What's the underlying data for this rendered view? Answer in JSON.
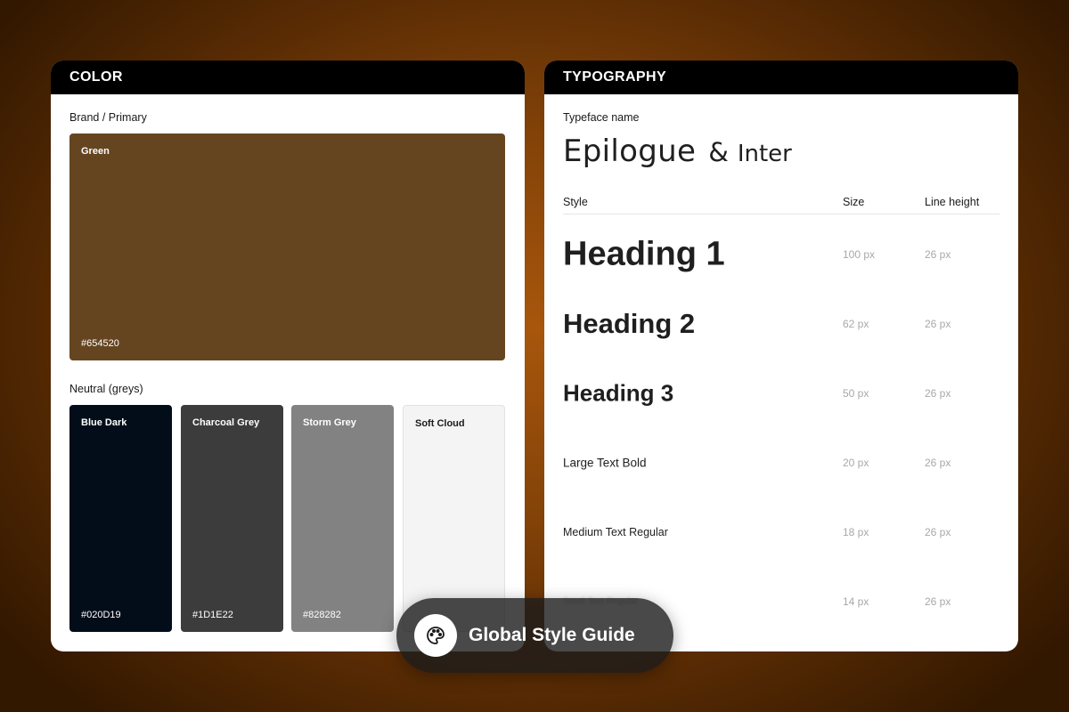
{
  "color_panel": {
    "title": "COLOR",
    "brand_label": "Brand / Primary",
    "brand": {
      "name": "Green",
      "hex": "#654520",
      "color": "#654520"
    },
    "neutral_label": "Neutral (greys)",
    "neutrals": [
      {
        "name": "Blue Dark",
        "hex": "#020D19",
        "color": "#020D19"
      },
      {
        "name": "Charcoal Grey",
        "hex": "#1D1E22",
        "color": "#3c3c3c"
      },
      {
        "name": "Storm Grey",
        "hex": "#828282",
        "color": "#828282"
      },
      {
        "name": "Soft Cloud",
        "hex": "",
        "color": "#f4f4f4"
      }
    ]
  },
  "typography_panel": {
    "title": "TYPOGRAPHY",
    "typeface_label": "Typeface name",
    "typeface_primary": "Epilogue",
    "typeface_amp": "&",
    "typeface_secondary": "Inter",
    "columns": {
      "style": "Style",
      "size": "Size",
      "line_height": "Line height"
    },
    "rows": [
      {
        "style": "Heading 1",
        "size": "100 px",
        "line_height": "26 px"
      },
      {
        "style": "Heading 2",
        "size": "62 px",
        "line_height": "26 px"
      },
      {
        "style": "Heading 3",
        "size": "50 px",
        "line_height": "26 px"
      },
      {
        "style": "Large Text Bold",
        "size": "20 px",
        "line_height": "26 px"
      },
      {
        "style": "Medium Text Regular",
        "size": "18 px",
        "line_height": "26 px"
      },
      {
        "style": "Small Text Regular",
        "size": "14 px",
        "line_height": "26 px"
      }
    ]
  },
  "pill": {
    "icon": "palette-icon",
    "label": "Global Style Guide"
  }
}
